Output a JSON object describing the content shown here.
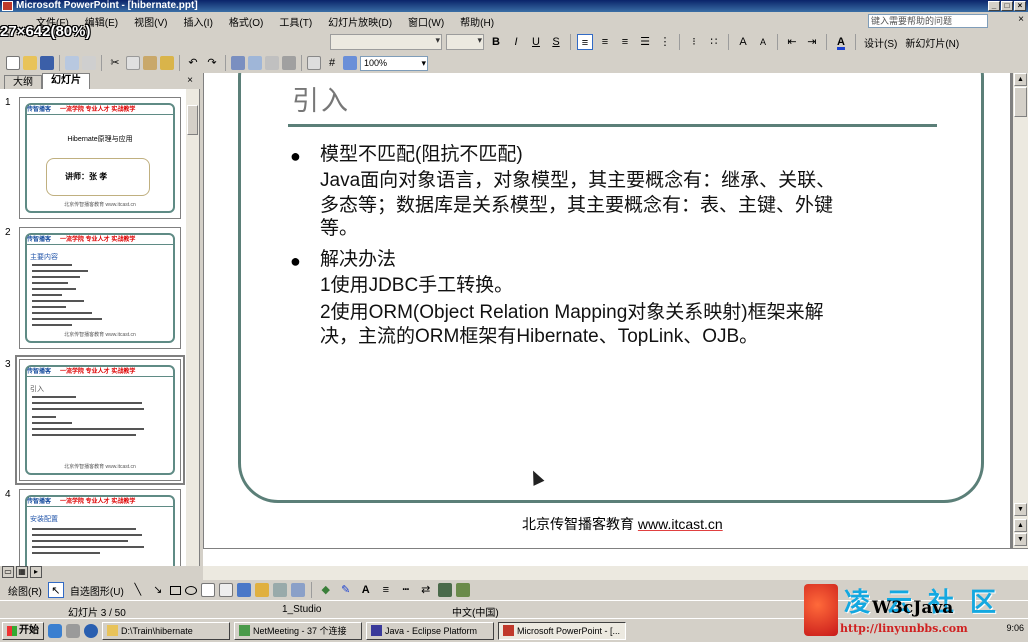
{
  "window": {
    "title": "Microsoft PowerPoint - [hibernate.ppt]",
    "controls": [
      "_",
      "□",
      "×"
    ]
  },
  "overlay": {
    "zoom_text": "27×642(80%)"
  },
  "menu": {
    "items": [
      "文件(F)",
      "编辑(E)",
      "视图(V)",
      "插入(I)",
      "格式(O)",
      "工具(T)",
      "幻灯片放映(D)",
      "窗口(W)",
      "帮助(H)"
    ],
    "help_placeholder": "键入需要帮助的问题",
    "close": "×"
  },
  "toolbar_formatting": {
    "bold": "B",
    "italic": "I",
    "underline": "U",
    "shadow": "S",
    "font_color_label": "A",
    "design_label": "设计(S)",
    "new_slide_label": "新幻灯片(N)"
  },
  "toolbar_standard": {
    "zoom": "100%"
  },
  "left_pane": {
    "tabs": [
      "大纲",
      "幻灯片"
    ],
    "close": "×",
    "thumbnails": [
      {
        "number": "1",
        "logo": "传智播客",
        "slogan": "一流学院 专业人才 实战教学",
        "center_text": "Hibernate原理与应用",
        "box_text": "讲师：张 孝",
        "footer": "北京传智播客教育 www.itcast.cn"
      },
      {
        "number": "2",
        "logo": "传智播客",
        "slogan": "一流学院 专业人才 实战教学",
        "heading": "主要内容",
        "footer": "北京传智播客教育 www.itcast.cn"
      },
      {
        "number": "3",
        "logo": "传智播客",
        "slogan": "一流学院 专业人才 实战教学",
        "heading": "引入",
        "footer": "北京传智播客教育 www.itcast.cn"
      },
      {
        "number": "4",
        "logo": "传智播客",
        "slogan": "一流学院 专业人才 实战教学",
        "heading": "安装配置",
        "footer": ""
      }
    ]
  },
  "slide": {
    "title": "引入",
    "bullets": [
      {
        "heading": "模型不匹配(阻抗不匹配)",
        "lines": [
          "Java面向对象语言，对象模型，其主要概念有：继承、关联、",
          "多态等；数据库是关系模型，其主要概念有：表、主键、外键",
          "等。"
        ]
      },
      {
        "heading": "解决办法",
        "lines": [
          "1使用JDBC手工转换。",
          "2使用ORM(Object Relation Mapping对象关系映射)框架来解",
          "决，主流的ORM框架有Hibernate、TopLink、OJB。"
        ]
      }
    ],
    "footer_org": "北京传智播客教育 ",
    "footer_url": "www.itcast.cn"
  },
  "drawing_toolbar": {
    "draw_label": "绘图(R)",
    "autoshapes_label": "自选图形(U)"
  },
  "status": {
    "slide_counter": "幻灯片 3 / 50",
    "design": "1_Studio",
    "language": "中文(中国)"
  },
  "watermark": {
    "cn": "凌云社区",
    "en": "W3cJava",
    "url": "http://linyunbbs.com"
  },
  "taskbar": {
    "start": "开始",
    "tasks": [
      "D:\\Train\\hibernate",
      "NetMeeting - 37 个连接",
      "Java - Eclipse Platform",
      "Microsoft PowerPoint - [..."
    ],
    "clock": "9:06"
  },
  "colors": {
    "slide_accent": "#5b7f78",
    "titlebar": "#0a246a",
    "logo_blue": "#1a4fa0",
    "slogan_red": "#dd0000"
  }
}
